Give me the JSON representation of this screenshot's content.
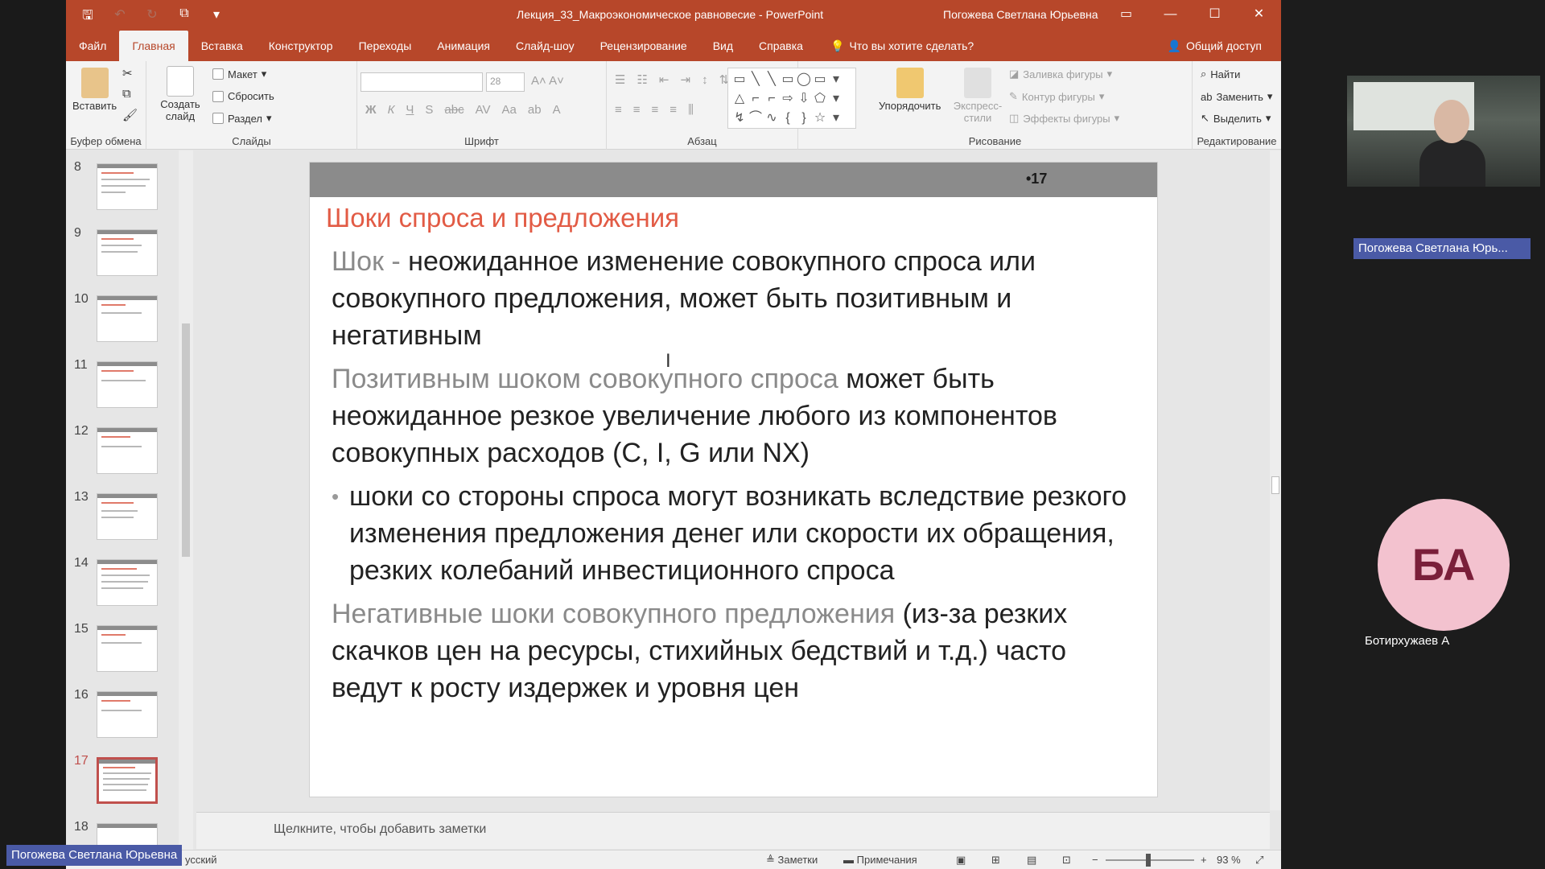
{
  "window": {
    "document_title": "Лекция_33_Макроэкономическое равновесие - PowerPoint",
    "user": "Погожева Светлана Юрьевна"
  },
  "tabs": [
    "Файл",
    "Главная",
    "Вставка",
    "Конструктор",
    "Переходы",
    "Анимация",
    "Слайд-шоу",
    "Рецензирование",
    "Вид",
    "Справка"
  ],
  "tell_me": "Что вы хотите сделать?",
  "share": "Общий доступ",
  "ribbon": {
    "clipboard": {
      "paste": "Вставить",
      "label": "Буфер обмена"
    },
    "slides": {
      "new_slide": "Создать слайд",
      "layout": "Макет",
      "reset": "Сбросить",
      "section": "Раздел",
      "label": "Слайды"
    },
    "font": {
      "size": "28",
      "label": "Шрифт"
    },
    "paragraph": {
      "label": "Абзац"
    },
    "drawing": {
      "arrange": "Упорядочить",
      "quick_styles": "Экспресс-стили",
      "fill": "Заливка фигуры",
      "outline": "Контур фигуры",
      "effects": "Эффекты фигуры",
      "label": "Рисование"
    },
    "editing": {
      "find": "Найти",
      "replace": "Заменить",
      "select": "Выделить",
      "label": "Редактирование"
    }
  },
  "thumbnails": [
    "8",
    "9",
    "10",
    "11",
    "12",
    "13",
    "14",
    "15",
    "16",
    "17",
    "18"
  ],
  "selected_slide": "17",
  "slide": {
    "number": "•17",
    "title": "Шоки спроса и предложения",
    "p1_term": "Шок - ",
    "p1_text": "неожиданное изменение совокупного спроса или совокупного предложения, может быть позитивным и негативным",
    "p2_term": "Позитивным шоком совокупного спроса",
    "p2_text": " может быть неожиданное резкое увеличение любого из компонентов совокупных расходов (C, I, G или NX)",
    "bullet": "шоки со стороны спроса могут возникать вследствие резкого изменения предложения денег или скорости их обращения, резких колебаний инвестиционного спроса",
    "p3_term": "Негативные шоки совокупного предложения",
    "p3_text": " (из-за резких скачков цен на ресурсы, стихийных бедствий и т.д.)  часто ведут к росту издержек и уровня цен"
  },
  "notes_placeholder": "Щелкните, чтобы добавить заметки",
  "status": {
    "language": "усский",
    "notes": "Заметки",
    "comments": "Примечания",
    "zoom": "93 %"
  },
  "video": {
    "speaker_label": "Погожева Светлана Юрь...",
    "participant_initials": "БА",
    "participant_name": "Ботирхужаев А",
    "presenter_tag": "Погожева Светлана Юрьевна"
  },
  "colors": {
    "accent": "#b7472a",
    "title_red": "#e25b45",
    "zoom_tag": "#4a5aa6",
    "avatar_bg": "#f3c2cf"
  }
}
